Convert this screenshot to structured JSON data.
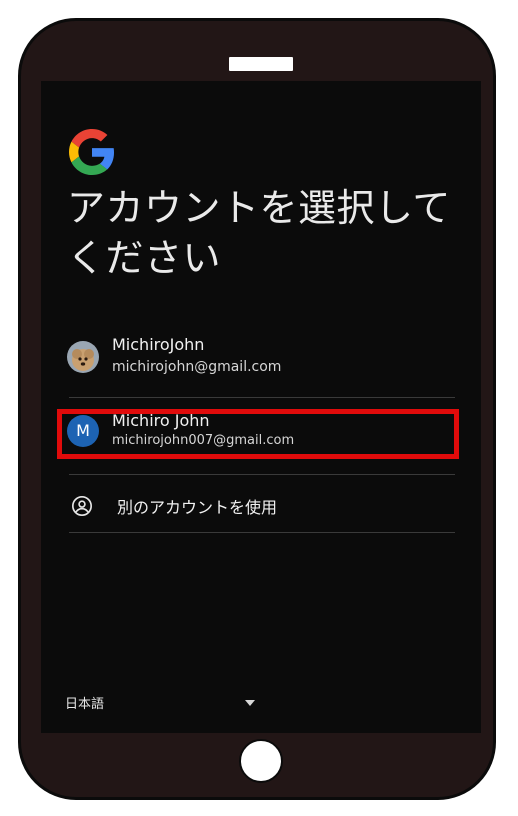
{
  "screen": {
    "title": "アカウントを選択してください",
    "accounts": [
      {
        "name": "MichiroJohn",
        "email": "michirojohn@gmail.com",
        "avatar": "photo-avatar"
      },
      {
        "name": "Michiro John",
        "email": "michirojohn007@gmail.com",
        "avatar_initial": "M"
      }
    ],
    "use_other_account": "別のアカウントを使用",
    "language": "日本語"
  },
  "colors": {
    "phone_body": "#221616",
    "screen_bg": "#0b0b0b",
    "highlight": "#e00b0b",
    "avatar_blue": "#1d63b3"
  },
  "icons": {
    "logo": "google-g-logo",
    "other_account": "account-circle-icon",
    "language_dropdown": "caret-down-icon"
  }
}
